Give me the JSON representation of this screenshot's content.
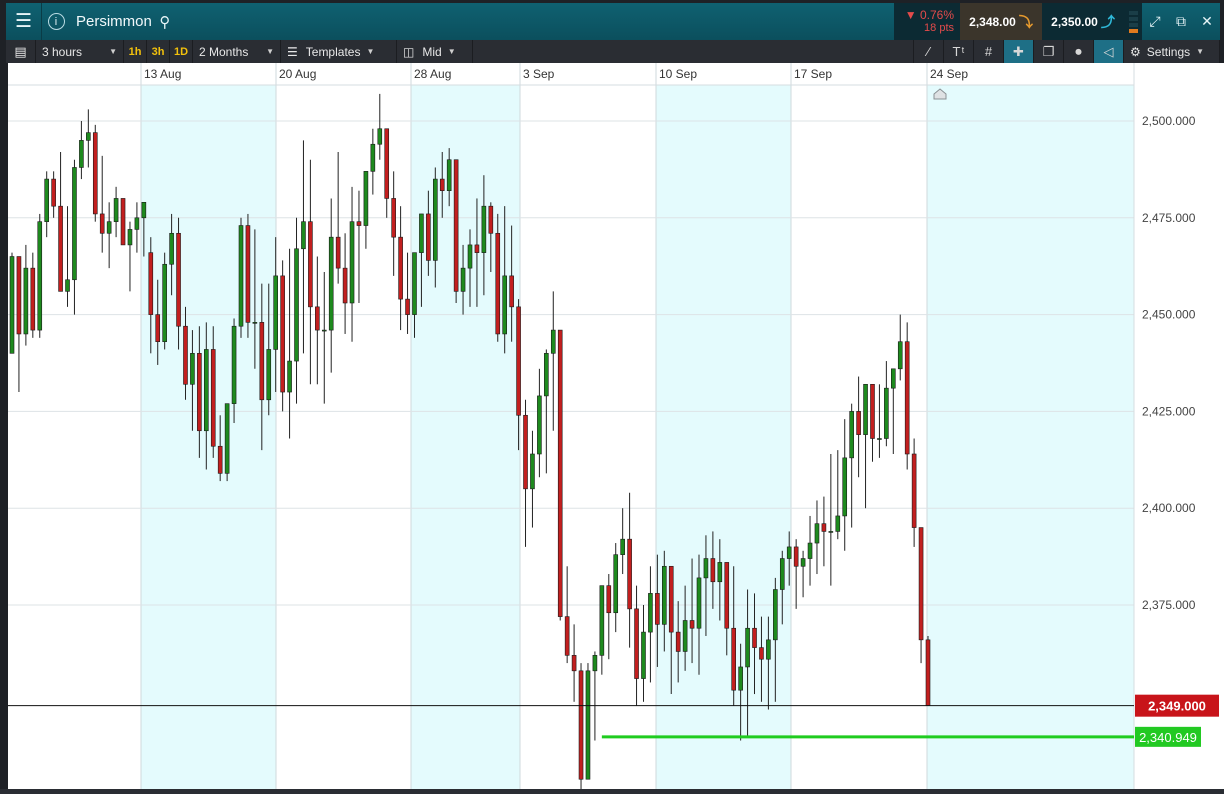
{
  "header": {
    "menu_icon": "hamburger-menu-icon",
    "info_glyph": "i",
    "instrument": "Persimmon",
    "change_pct": "▼ 0.76%",
    "change_pts": "18 pts",
    "sell_price": "2,348.00",
    "buy_price": "2,350.00"
  },
  "toolbar": {
    "interval": "3 hours",
    "resolutions": [
      "1h",
      "3h",
      "1D"
    ],
    "range": "2 Months",
    "templates": "Templates",
    "price_type": "Mid",
    "settings": "Settings"
  },
  "chart_data": {
    "type": "candlestick",
    "dates": [
      "13 Aug",
      "20 Aug",
      "28 Aug",
      "3 Sep",
      "10 Sep",
      "17 Sep",
      "24 Sep"
    ],
    "y_ticks": [
      "2,500.000",
      "2,475.000",
      "2,450.000",
      "2,425.000",
      "2,400.000",
      "2,375.000"
    ],
    "ylim": [
      2318,
      2518
    ],
    "current_price_label": "2,349.000",
    "current_price": 2349,
    "support_label": "2,340.949",
    "support_price": 2340.949,
    "up_color": "#1e8a1e",
    "down_color": "#c21f1f",
    "candles": [
      [
        2440,
        2466,
        2440,
        2465
      ],
      [
        2465,
        2460,
        2430,
        2445
      ],
      [
        2445,
        2468,
        2442,
        2462
      ],
      [
        2462,
        2466,
        2444,
        2446
      ],
      [
        2446,
        2476,
        2444,
        2474
      ],
      [
        2474,
        2487,
        2470,
        2485
      ],
      [
        2485,
        2487,
        2475,
        2478
      ],
      [
        2478,
        2492,
        2456,
        2456
      ],
      [
        2456,
        2478,
        2452,
        2459
      ],
      [
        2459,
        2490,
        2450,
        2488
      ],
      [
        2488,
        2500,
        2485,
        2495
      ],
      [
        2495,
        2503,
        2488,
        2497
      ],
      [
        2497,
        2499,
        2474,
        2476
      ],
      [
        2476,
        2491,
        2466,
        2471
      ],
      [
        2471,
        2479,
        2462,
        2474
      ],
      [
        2474,
        2483,
        2470,
        2480
      ],
      [
        2480,
        2480,
        2468,
        2468
      ],
      [
        2468,
        2474,
        2456,
        2472
      ],
      [
        2472,
        2479,
        2466,
        2475
      ],
      [
        2475,
        2478,
        2465,
        2479
      ],
      [
        2466,
        2470,
        2440,
        2450
      ],
      [
        2450,
        2459,
        2437,
        2443
      ],
      [
        2443,
        2466,
        2441,
        2463
      ],
      [
        2463,
        2476,
        2455,
        2471
      ],
      [
        2471,
        2475,
        2441,
        2447
      ],
      [
        2447,
        2452,
        2428,
        2432
      ],
      [
        2432,
        2446,
        2420,
        2440
      ],
      [
        2440,
        2447,
        2413,
        2420
      ],
      [
        2420,
        2448,
        2410,
        2441
      ],
      [
        2441,
        2447,
        2413,
        2416
      ],
      [
        2416,
        2424,
        2407,
        2409
      ],
      [
        2409,
        2425,
        2407,
        2427
      ],
      [
        2427,
        2449,
        2422,
        2447
      ],
      [
        2447,
        2475,
        2444,
        2473
      ],
      [
        2473,
        2476,
        2444,
        2448
      ],
      [
        2448,
        2472,
        2436,
        2448
      ],
      [
        2448,
        2458,
        2415,
        2428
      ],
      [
        2428,
        2458,
        2424,
        2441
      ],
      [
        2441,
        2470,
        2430,
        2460
      ],
      [
        2460,
        2464,
        2425,
        2430
      ],
      [
        2430,
        2467,
        2418,
        2438
      ],
      [
        2438,
        2475,
        2427,
        2467
      ],
      [
        2467,
        2495,
        2440,
        2474
      ],
      [
        2474,
        2490,
        2432,
        2452
      ],
      [
        2452,
        2465,
        2432,
        2446
      ],
      [
        2446,
        2461,
        2427,
        2446
      ],
      [
        2446,
        2480,
        2435,
        2470
      ],
      [
        2470,
        2492,
        2458,
        2462
      ],
      [
        2462,
        2471,
        2445,
        2453
      ],
      [
        2453,
        2483,
        2443,
        2474
      ],
      [
        2474,
        2482,
        2453,
        2473
      ],
      [
        2473,
        2487,
        2467,
        2487
      ],
      [
        2487,
        2498,
        2481,
        2494
      ],
      [
        2494,
        2507,
        2490,
        2498
      ],
      [
        2498,
        2494,
        2475,
        2480
      ],
      [
        2480,
        2487,
        2460,
        2470
      ],
      [
        2470,
        2478,
        2446,
        2454
      ],
      [
        2454,
        2466,
        2445,
        2450
      ],
      [
        2450,
        2465,
        2444,
        2466
      ],
      [
        2466,
        2468,
        2452,
        2476
      ],
      [
        2476,
        2482,
        2460,
        2464
      ],
      [
        2464,
        2488,
        2457,
        2485
      ],
      [
        2485,
        2492,
        2475,
        2482
      ],
      [
        2482,
        2493,
        2478,
        2490
      ],
      [
        2490,
        2490,
        2453,
        2456
      ],
      [
        2456,
        2468,
        2450,
        2462
      ],
      [
        2462,
        2472,
        2452,
        2468
      ],
      [
        2468,
        2480,
        2452,
        2466
      ],
      [
        2466,
        2486,
        2455,
        2478
      ],
      [
        2478,
        2479,
        2461,
        2471
      ],
      [
        2471,
        2476,
        2443,
        2445
      ],
      [
        2445,
        2478,
        2440,
        2460
      ],
      [
        2460,
        2473,
        2443,
        2452
      ],
      [
        2452,
        2454,
        2415,
        2424
      ],
      [
        2424,
        2428,
        2390,
        2405
      ],
      [
        2405,
        2420,
        2395,
        2414
      ],
      [
        2414,
        2436,
        2408,
        2429
      ],
      [
        2429,
        2441,
        2409,
        2440
      ],
      [
        2440,
        2456,
        2420,
        2446
      ],
      [
        2446,
        2434,
        2371,
        2372
      ],
      [
        2372,
        2385,
        2360,
        2362
      ],
      [
        2362,
        2370,
        2350,
        2358
      ],
      [
        2358,
        2360,
        2324,
        2330
      ],
      [
        2330,
        2360,
        2332,
        2358
      ],
      [
        2358,
        2363,
        2340,
        2362
      ],
      [
        2362,
        2374,
        2357,
        2380
      ],
      [
        2380,
        2383,
        2361,
        2373
      ],
      [
        2373,
        2391,
        2368,
        2388
      ],
      [
        2388,
        2400,
        2383,
        2392
      ],
      [
        2392,
        2404,
        2364,
        2374
      ],
      [
        2374,
        2380,
        2349,
        2356
      ],
      [
        2356,
        2375,
        2350,
        2368
      ],
      [
        2368,
        2385,
        2355,
        2378
      ],
      [
        2378,
        2388,
        2359,
        2370
      ],
      [
        2370,
        2389,
        2363,
        2385
      ],
      [
        2385,
        2373,
        2352,
        2368
      ],
      [
        2368,
        2376,
        2355,
        2363
      ],
      [
        2363,
        2380,
        2358,
        2371
      ],
      [
        2371,
        2387,
        2360,
        2369
      ],
      [
        2369,
        2388,
        2357,
        2382
      ],
      [
        2382,
        2393,
        2367,
        2387
      ],
      [
        2387,
        2394,
        2374,
        2381
      ],
      [
        2381,
        2392,
        2371,
        2386
      ],
      [
        2386,
        2383,
        2362,
        2369
      ],
      [
        2369,
        2385,
        2349,
        2353
      ],
      [
        2353,
        2365,
        2340,
        2359
      ],
      [
        2359,
        2379,
        2341,
        2369
      ],
      [
        2369,
        2378,
        2352,
        2364
      ],
      [
        2364,
        2372,
        2350,
        2361
      ],
      [
        2361,
        2372,
        2348,
        2366
      ],
      [
        2366,
        2382,
        2350,
        2379
      ],
      [
        2379,
        2389,
        2370,
        2387
      ],
      [
        2387,
        2394,
        2380,
        2390
      ],
      [
        2390,
        2392,
        2374,
        2385
      ],
      [
        2385,
        2389,
        2377,
        2387
      ],
      [
        2387,
        2398,
        2380,
        2391
      ],
      [
        2391,
        2402,
        2383,
        2396
      ],
      [
        2396,
        2403,
        2385,
        2394
      ],
      [
        2394,
        2414,
        2380,
        2394
      ],
      [
        2394,
        2415,
        2392,
        2398
      ],
      [
        2398,
        2423,
        2389,
        2413
      ],
      [
        2413,
        2427,
        2395,
        2425
      ],
      [
        2425,
        2434,
        2408,
        2419
      ],
      [
        2419,
        2427,
        2400,
        2432
      ],
      [
        2432,
        2432,
        2412,
        2418
      ],
      [
        2418,
        2432,
        2413,
        2418
      ],
      [
        2418,
        2438,
        2416,
        2431
      ],
      [
        2431,
        2434,
        2414,
        2436
      ],
      [
        2436,
        2450,
        2433,
        2443
      ],
      [
        2443,
        2448,
        2410,
        2414
      ],
      [
        2414,
        2418,
        2390,
        2395
      ],
      [
        2395,
        2393,
        2360,
        2366
      ],
      [
        2366,
        2367,
        2352,
        2349
      ]
    ]
  }
}
